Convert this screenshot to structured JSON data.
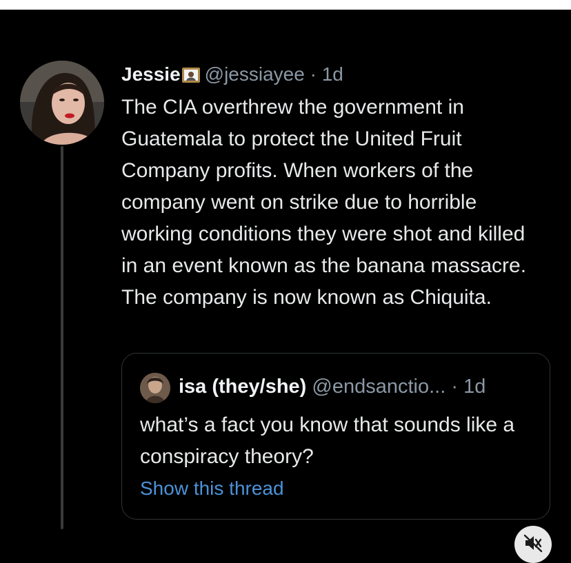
{
  "tweet": {
    "author_name": "Jessie",
    "handle": "@jessiayee",
    "separator": "·",
    "time": "1d",
    "text": "The CIA overthrew the government in Guatemala to protect the United Fruit Company profits. When workers of the company went on strike due to horrible working conditions they were shot and killed in an event known as the banana massacre. The company is now known as Chiquita."
  },
  "quoted_tweet": {
    "author_name": "isa (they/she)",
    "handle": "@endsanctio...",
    "separator": "·",
    "time": "1d",
    "text": "what’s a fact you know that sounds like a conspiracy theory?",
    "show_thread_label": "Show this thread"
  },
  "icons": {
    "author_emoji": "frame-with-picture-emoji",
    "mute": "speaker-muted-icon"
  },
  "colors": {
    "background": "#000000",
    "text": "#e7e9ea",
    "secondary": "#8b98a5",
    "link": "#4b92d8",
    "border": "#2f3336"
  }
}
